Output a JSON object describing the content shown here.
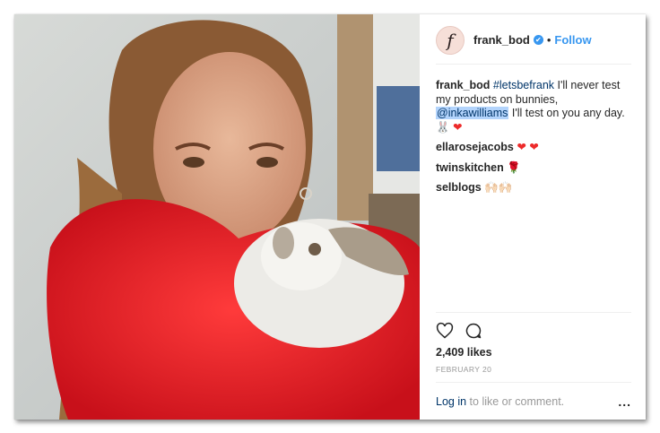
{
  "post": {
    "avatar_letter": "f",
    "username": "frank_bod",
    "verified_mark": "✔",
    "separator": "•",
    "follow_label": "Follow"
  },
  "caption": {
    "username": "frank_bod",
    "hashtag": "#letsbefrank",
    "text_before_mention": "I'll never test my products on bunnies,",
    "mention": "@inkawilliams",
    "text_after_mention": "I'll test on you any day.",
    "emoji": "🐰 ❤"
  },
  "comments": [
    {
      "username": "ellarosejacobs",
      "emoji": "❤ ❤"
    },
    {
      "username": "twinskitchen",
      "emoji": "🌹"
    },
    {
      "username": "selblogs",
      "emoji": "🙌🏻🙌🏻"
    }
  ],
  "actions": {
    "like_icon": "heart-outline-icon",
    "comment_icon": "comment-bubble-icon"
  },
  "likes": "2,409 likes",
  "date": "FEBRUARY 20",
  "footer": {
    "login_label": "Log in",
    "login_suffix": "to like or comment.",
    "more_label": "..."
  },
  "colors": {
    "accent": "#3897f0",
    "link": "#003569",
    "heart": "#ed2b2b",
    "muted": "#999999"
  }
}
